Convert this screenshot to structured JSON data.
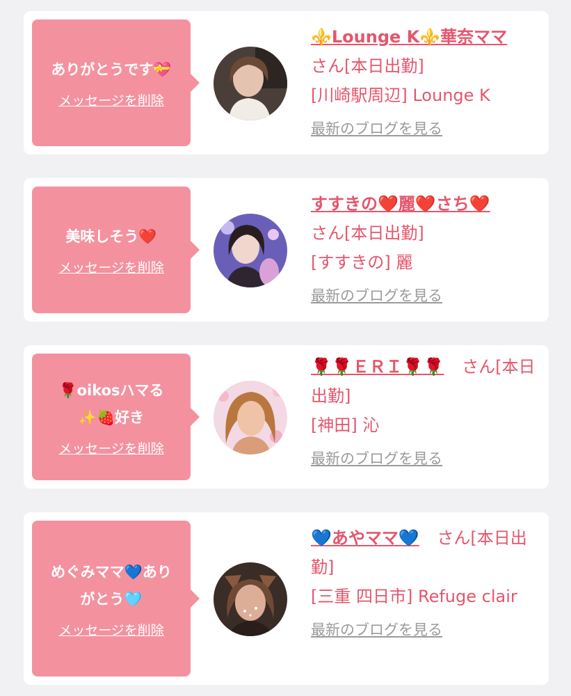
{
  "delete_label": "メッセージを削除",
  "blog_label": "最新のブログを見る",
  "colors": {
    "accent": "#e5566c",
    "bubble": "#f4919f",
    "background": "#f1f1f3",
    "link_gray": "#9a9a9a"
  },
  "cards": [
    {
      "message": "ありがとうです💝",
      "name": "⚜️Lounge K⚜️華奈ママ",
      "suffix": "さん[本日出勤]",
      "location": "[川崎駅周辺] Lounge K"
    },
    {
      "message": "美味しそう❤️",
      "name": "すすきの❤️麗❤️さち❤️",
      "suffix": "さん[本日出勤]",
      "location": "[すすきの] 麗"
    },
    {
      "message_line1": "🌹oikosハマる",
      "message_line2": "✨🍓好き",
      "name": "🌹🌹ＥＲＩ🌹🌹",
      "suffix": "さん[本日出勤]",
      "location": "[神田] 沁"
    },
    {
      "message_line1": "めぐみママ💙あり",
      "message_line2": "がとう🩵",
      "name": "💙あやママ💙",
      "suffix": "さん[本日出勤]",
      "location": "[三重 四日市] Refuge clair"
    }
  ]
}
